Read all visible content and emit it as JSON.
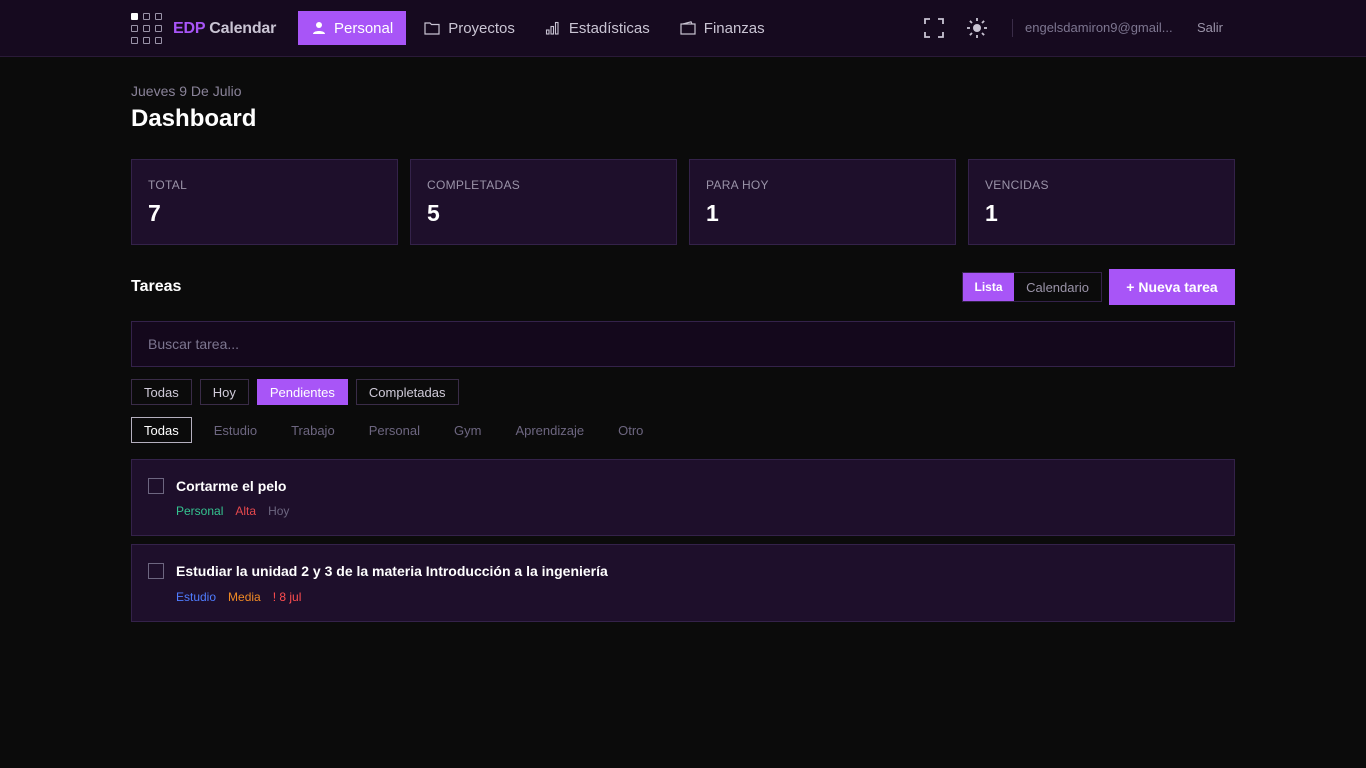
{
  "app": {
    "brand_prefix": "EDP",
    "brand_name": "Calendar"
  },
  "nav": [
    {
      "label": "Personal",
      "icon": "user-icon",
      "active": true
    },
    {
      "label": "Proyectos",
      "icon": "folder-icon",
      "active": false
    },
    {
      "label": "Estadísticas",
      "icon": "bar-chart-icon",
      "active": false
    },
    {
      "label": "Finanzas",
      "icon": "wallet-icon",
      "active": false
    }
  ],
  "user": {
    "email": "engelsdamiron9@gmail...",
    "logout_label": "Salir"
  },
  "header": {
    "date": "Jueves 9 De Julio",
    "title": "Dashboard"
  },
  "stats": [
    {
      "label": "TOTAL",
      "value": "7"
    },
    {
      "label": "COMPLETADAS",
      "value": "5"
    },
    {
      "label": "PARA HOY",
      "value": "1"
    },
    {
      "label": "VENCIDAS",
      "value": "1"
    }
  ],
  "tasks_section": {
    "title": "Tareas",
    "view_list": "Lista",
    "view_calendar": "Calendario",
    "new_task": "+ Nueva tarea",
    "search_placeholder": "Buscar tarea..."
  },
  "status_filters": [
    {
      "label": "Todas",
      "active": false
    },
    {
      "label": "Hoy",
      "active": false
    },
    {
      "label": "Pendientes",
      "active": true
    },
    {
      "label": "Completadas",
      "active": false
    }
  ],
  "category_filters": [
    {
      "label": "Todas",
      "active": true
    },
    {
      "label": "Estudio",
      "active": false
    },
    {
      "label": "Trabajo",
      "active": false
    },
    {
      "label": "Personal",
      "active": false
    },
    {
      "label": "Gym",
      "active": false
    },
    {
      "label": "Aprendizaje",
      "active": false
    },
    {
      "label": "Otro",
      "active": false
    }
  ],
  "tasks": [
    {
      "title": "Cortarme el pelo",
      "category": "Personal",
      "category_color": "#34c38f",
      "priority": "Alta",
      "priority_color": "#e5484d",
      "due": "Hoy",
      "due_color": "#6d6680"
    },
    {
      "title": "Estudiar la unidad 2 y 3 de la materia Introducción a la ingeniería",
      "category": "Estudio",
      "category_color": "#4f7cff",
      "priority": "Media",
      "priority_color": "#f08a24",
      "due": "! 8 jul",
      "due_color": "#ff4d4f"
    }
  ],
  "colors": {
    "accent": "#a855f7",
    "background": "#0b0b0b",
    "card": "#1e0f2b"
  }
}
